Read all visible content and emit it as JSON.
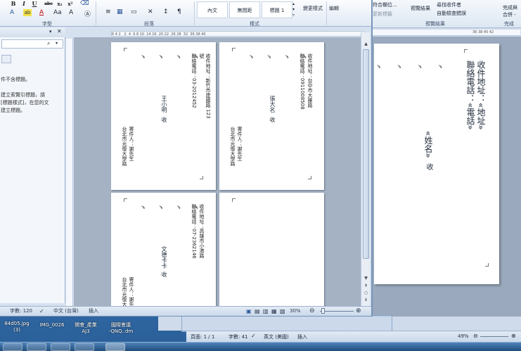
{
  "desktop": {
    "icons": [
      "84d05.jpg",
      "(3)",
      "IMG_0026",
      "開會_產業",
      "AJ3",
      "國際會議",
      "-QNQ..dm"
    ]
  },
  "back_window": {
    "ribbon": {
      "merge_field": "符合欄位...",
      "update_labels": "更新標籤",
      "preview_results": "預覽結果",
      "find_recipient": "尋找收件者",
      "auto_check": "自動檢查錯誤",
      "preview_group": "預覽結果",
      "finish_merge": "完成與",
      "merge_sub": "合併 -",
      "finish_group": "完成"
    },
    "ruler_text": "36 38 40 42",
    "page": {
      "address_label": "收件地址：«地址»",
      "phone_label": "聯絡電話：«電話»",
      "name_label": "«姓名»",
      "receive": "收"
    },
    "status": {
      "page": "頁面: 1 / 1",
      "words": "字數: 41",
      "language": "英文 (美國)",
      "insert": "插入",
      "zoom": "49%"
    }
  },
  "front_window": {
    "ribbon": {
      "bold": "B",
      "italic": "I",
      "underline": "U",
      "strike": "abc",
      "sub": "x₂",
      "sup": "x²",
      "font_group": "字型",
      "paragraph_group": "段落",
      "style_normal": "內文",
      "style_nospace": "無間距",
      "style_h1": "標題 1",
      "change_styles": "變更樣式",
      "styles_group": "樣式",
      "editing": "編輯"
    },
    "nav": {
      "message_lines": [
        "件不含標題。",
        "",
        "建立索覽引標題，請",
        "[標題樣式]，在您的文",
        "建立標題。"
      ]
    },
    "hruler_text": "6 4 2   2  4  6 8 10  14 16  20 22  26 28  32  36 38 40",
    "pages": [
      {
        "return_address": "寄件人：謝先生",
        "return_line2": "台北市光復大學路",
        "address": "收件地址：新竹市建國路 123 號",
        "phone": "聯絡電話：03-2012452",
        "name": "王小明",
        "receive": "收"
      },
      {
        "return_address": "寄件人：謝先生",
        "return_line2": "台北市光復大學路",
        "address": "收件地址：台中市大雅路",
        "phone": "聯絡電話：0911008508",
        "name": "張大名",
        "receive": "收"
      },
      {
        "return_address": "寄件人：謝先",
        "return_line2": "台北市光復大",
        "address": "收件地址：高雄市小港路",
        "phone": "聯絡電話：07-2362146",
        "name": "文德卡卡",
        "receive": "收"
      },
      {
        "return_address": "",
        "return_line2": "",
        "address": "",
        "phone": "",
        "name": "",
        "receive": ""
      }
    ],
    "status": {
      "words": "字數: 120",
      "language": "中文 (台灣)",
      "insert": "插入",
      "zoom": "30%"
    },
    "zoom_fraction": 0.05
  },
  "colors": {
    "accent": "#2b579a",
    "workspace": "#a4b2c4"
  }
}
